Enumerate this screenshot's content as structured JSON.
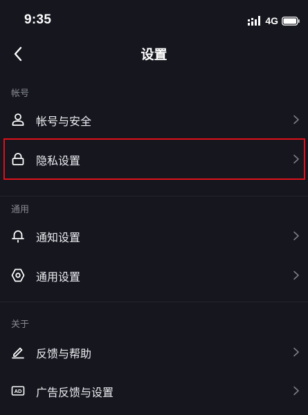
{
  "status_bar": {
    "time": "9:35",
    "network": "4G",
    "signal_icon": "signal-bars-icon",
    "battery_icon": "battery-icon"
  },
  "nav": {
    "title": "设置",
    "back_icon": "chevron-left-icon"
  },
  "sections": [
    {
      "label": "帐号",
      "items": [
        {
          "label": "帐号与安全",
          "icon": "user-icon"
        },
        {
          "label": "隐私设置",
          "icon": "lock-icon",
          "highlighted": true
        }
      ]
    },
    {
      "label": "通用",
      "items": [
        {
          "label": "通知设置",
          "icon": "bell-icon"
        },
        {
          "label": "通用设置",
          "icon": "gear-icon"
        }
      ]
    },
    {
      "label": "关于",
      "items": [
        {
          "label": "反馈与帮助",
          "icon": "pencil-icon"
        },
        {
          "label": "广告反馈与设置",
          "icon": "ad-icon"
        }
      ]
    }
  ],
  "colors": {
    "background": "#15161e",
    "text": "#ffffff",
    "section_label": "#8a8b92",
    "chevron": "#7d7e86",
    "highlight": "#e0101a"
  }
}
